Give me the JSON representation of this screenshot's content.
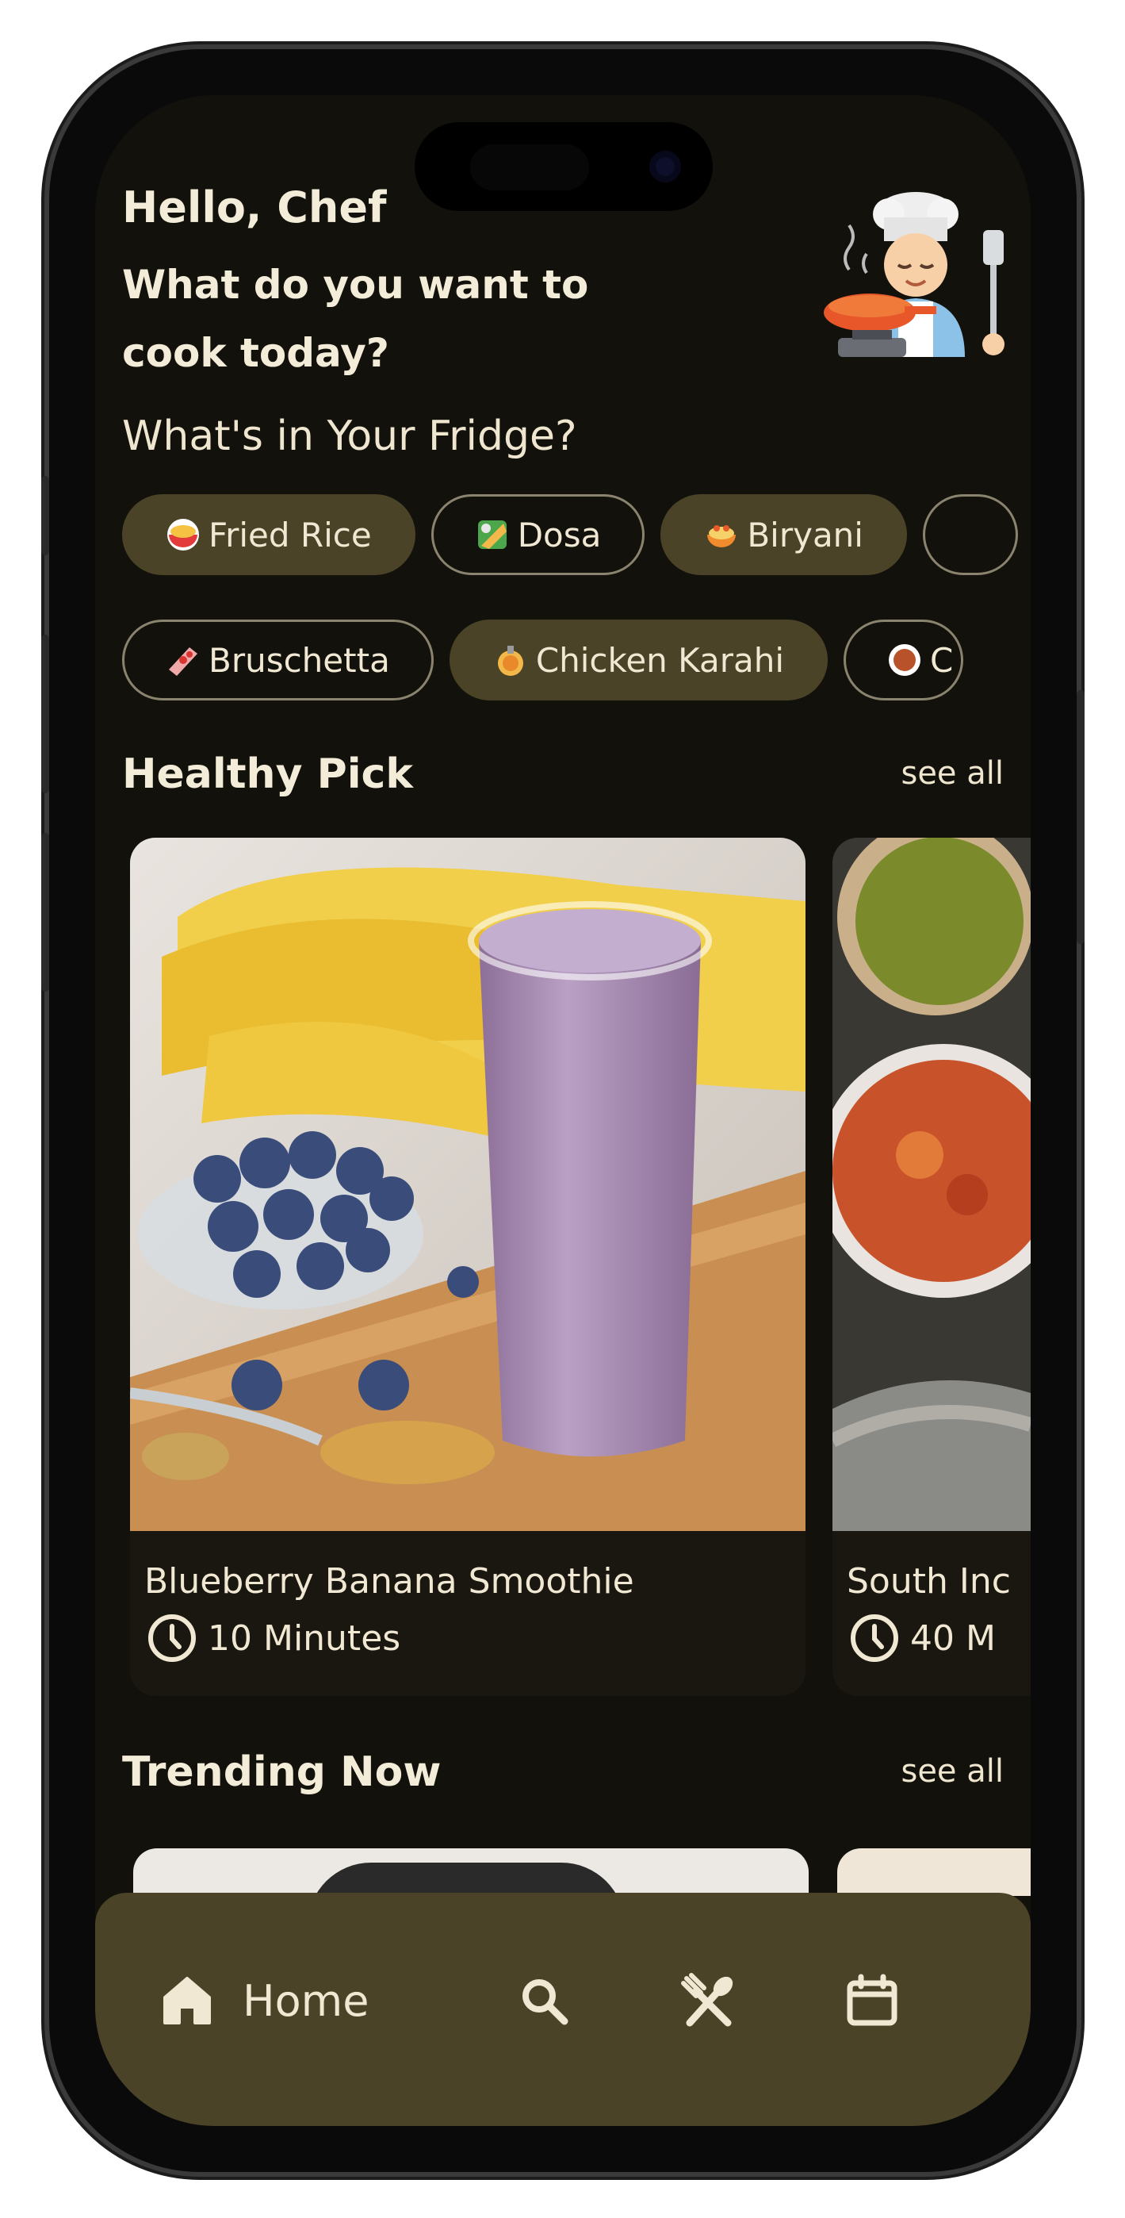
{
  "header": {
    "greeting": "Hello, Chef",
    "question": "What do you want to cook today?"
  },
  "fridge": {
    "title": "What's in Your Fridge?",
    "row1": [
      {
        "label": "Fried Rice",
        "icon": "rice-bowl-icon",
        "selected": true
      },
      {
        "label": "Dosa",
        "icon": "dosa-icon",
        "selected": false
      },
      {
        "label": "Biryani",
        "icon": "biryani-icon",
        "selected": true
      },
      {
        "label": "",
        "icon": "",
        "selected": false
      }
    ],
    "row2": [
      {
        "label": "Bruschetta",
        "icon": "bruschetta-icon",
        "selected": false
      },
      {
        "label": "Chicken Karahi",
        "icon": "karahi-icon",
        "selected": true
      },
      {
        "label": "C",
        "icon": "dish-icon",
        "selected": false
      }
    ]
  },
  "healthy_pick": {
    "title": "Healthy Pick",
    "see_all": "see all",
    "cards": [
      {
        "name": "Blueberry Banana Smoothie",
        "time": "10 Minutes"
      },
      {
        "name": "South Inc",
        "time": "40 M"
      }
    ]
  },
  "trending": {
    "title": "Trending Now",
    "see_all": "see all"
  },
  "nav": {
    "home_label": "Home"
  },
  "colors": {
    "background": "#13110c",
    "chip_selected": "#4a4327",
    "nav_bar": "#4a4327",
    "text": "#f0e8d2"
  }
}
